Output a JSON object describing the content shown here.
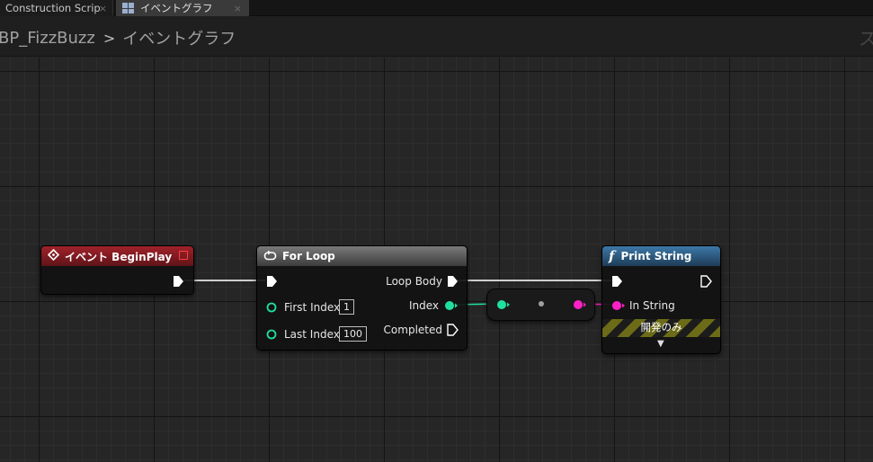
{
  "tabs": [
    {
      "label": "Construction Scrip",
      "active": false
    },
    {
      "label": "イベントグラフ",
      "active": true
    }
  ],
  "tab_close_glyph": "×",
  "breadcrumb": {
    "blueprint": "BP_FizzBuzz",
    "separator": ">",
    "graph": "イベントグラフ",
    "right_text": "ス"
  },
  "nodes": {
    "begin_play": {
      "title": "イベント BeginPlay",
      "icon": "event-diamond-icon"
    },
    "for_loop": {
      "title": "For Loop",
      "icon": "loop-icon",
      "inputs": [
        {
          "label": "First Index",
          "value": "1"
        },
        {
          "label": "Last Index",
          "value": "100"
        }
      ],
      "outputs": [
        "Loop Body",
        "Index",
        "Completed"
      ]
    },
    "print_string": {
      "title": "Print String",
      "icon": "function-icon",
      "inputs": [
        "In String"
      ],
      "dev_only_label": "開発のみ",
      "expand_glyph": "▼"
    }
  },
  "colors": {
    "exec": "#ffffff",
    "int_pin": "#20e0a0",
    "string_pin": "#ff20c8",
    "event_header": "#a0222a",
    "function_header": "#3d78a8",
    "delegate_pin": "#ff4040"
  }
}
